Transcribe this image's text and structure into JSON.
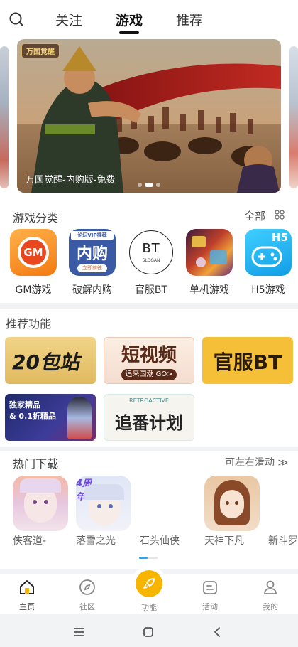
{
  "header": {
    "tabs": [
      {
        "label": "关注",
        "active": false
      },
      {
        "label": "游戏",
        "active": true
      },
      {
        "label": "推荐",
        "active": false
      }
    ],
    "search_icon": "search-icon"
  },
  "banner": {
    "caption": "万国觉醒-内购版-免费",
    "logo_text": "万国觉醒",
    "dots": 3,
    "active_dot": 1
  },
  "categories": {
    "title": "游戏分类",
    "all_label": "全部",
    "all_icon": "grid-icon",
    "items": [
      {
        "label": "GM游戏",
        "icon_text": "GM",
        "color": "#f7941d"
      },
      {
        "label": "破解内购",
        "icon_text": "内购",
        "badge": "论坛VIP推荐",
        "sub": "立即前往",
        "color": "#3f5fa8"
      },
      {
        "label": "官服BT",
        "icon_text": "BT",
        "sub": "SLOGAN",
        "color": "#ffffff"
      },
      {
        "label": "单机游戏",
        "color": "#c0402a"
      },
      {
        "label": "H5游戏",
        "icon_text": "H5",
        "color": "#1fb6f0"
      }
    ]
  },
  "features": {
    "title": "推荐功能",
    "items": [
      {
        "label": "20包站"
      },
      {
        "label": "短视频",
        "sub": "追来国潮 GO>"
      },
      {
        "label": "官服BT"
      },
      {
        "label": "独家精品\n& 0.1折精品"
      },
      {
        "label": "追番计划",
        "sub": "RETROACTIVE"
      }
    ]
  },
  "hot": {
    "title": "热门下载",
    "more_label": "可左右滑动 ≫",
    "items": [
      {
        "label": "侠客道-"
      },
      {
        "label": "落雪之光",
        "badge": "4周年"
      },
      {
        "label": "石头仙侠"
      },
      {
        "label": "天神下凡"
      },
      {
        "label": "新斗罗"
      }
    ]
  },
  "bottom_nav": [
    {
      "label": "主页",
      "icon": "home-icon",
      "active": true
    },
    {
      "label": "社区",
      "icon": "compass-icon",
      "active": false
    },
    {
      "label": "功能",
      "icon": "rocket-icon",
      "active": false
    },
    {
      "label": "活动",
      "icon": "activity-icon",
      "active": false
    },
    {
      "label": "我的",
      "icon": "user-icon",
      "active": false
    }
  ],
  "colors": {
    "accent": "#f7b500",
    "nav_active": "#333333",
    "scroll_indicator": "#2aa3f2"
  }
}
